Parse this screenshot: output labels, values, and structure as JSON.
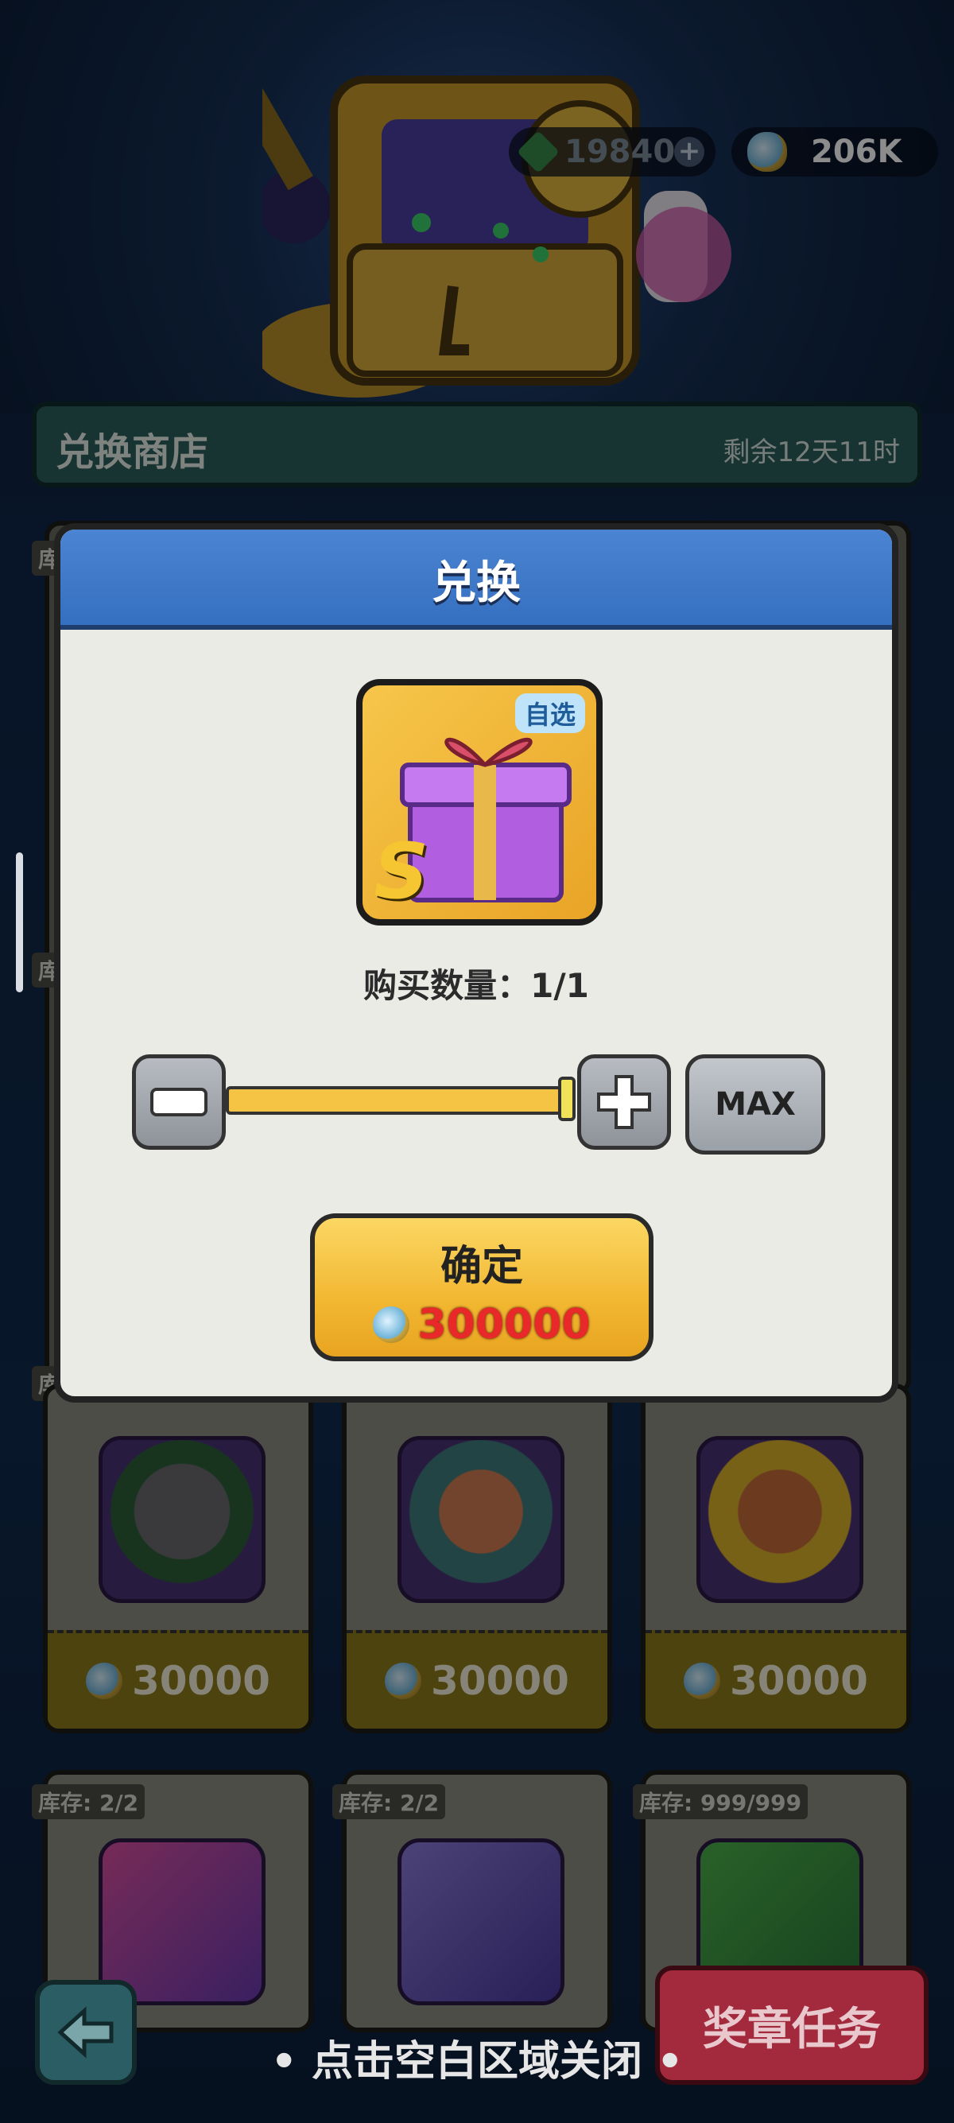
{
  "currency": {
    "gems": "19840",
    "gems_plus": "+",
    "coins": "206K",
    "coins_hidden": "206K"
  },
  "shop": {
    "title": "兑换商店",
    "remaining": "剩余12天11时"
  },
  "cards_row1": [
    {
      "stock": "库",
      "price": "30000"
    },
    {
      "stock": "",
      "price": "30000"
    },
    {
      "stock": "",
      "price": "30000"
    }
  ],
  "cards_row2": [
    {
      "stock": "库存: 2/2"
    },
    {
      "stock": "库存: 2/2"
    },
    {
      "stock": "库存: 999/999"
    }
  ],
  "side_stock": [
    "库",
    "库",
    "库"
  ],
  "dialog": {
    "title": "兑换",
    "item_tag": "自选",
    "item_letter": "S",
    "qty_label": "购买数量：1/1",
    "max_label": "MAX",
    "confirm_label": "确定",
    "cost": "300000"
  },
  "bottom": {
    "task_label": "奖章任务",
    "close_hint": "• 点击空白区域关闭 •"
  },
  "colors": {
    "dialog_header": "#3f7acb",
    "confirm_button": "#f2b731",
    "cost_text": "#e9282a",
    "shop_header": "#2c5f5c"
  }
}
